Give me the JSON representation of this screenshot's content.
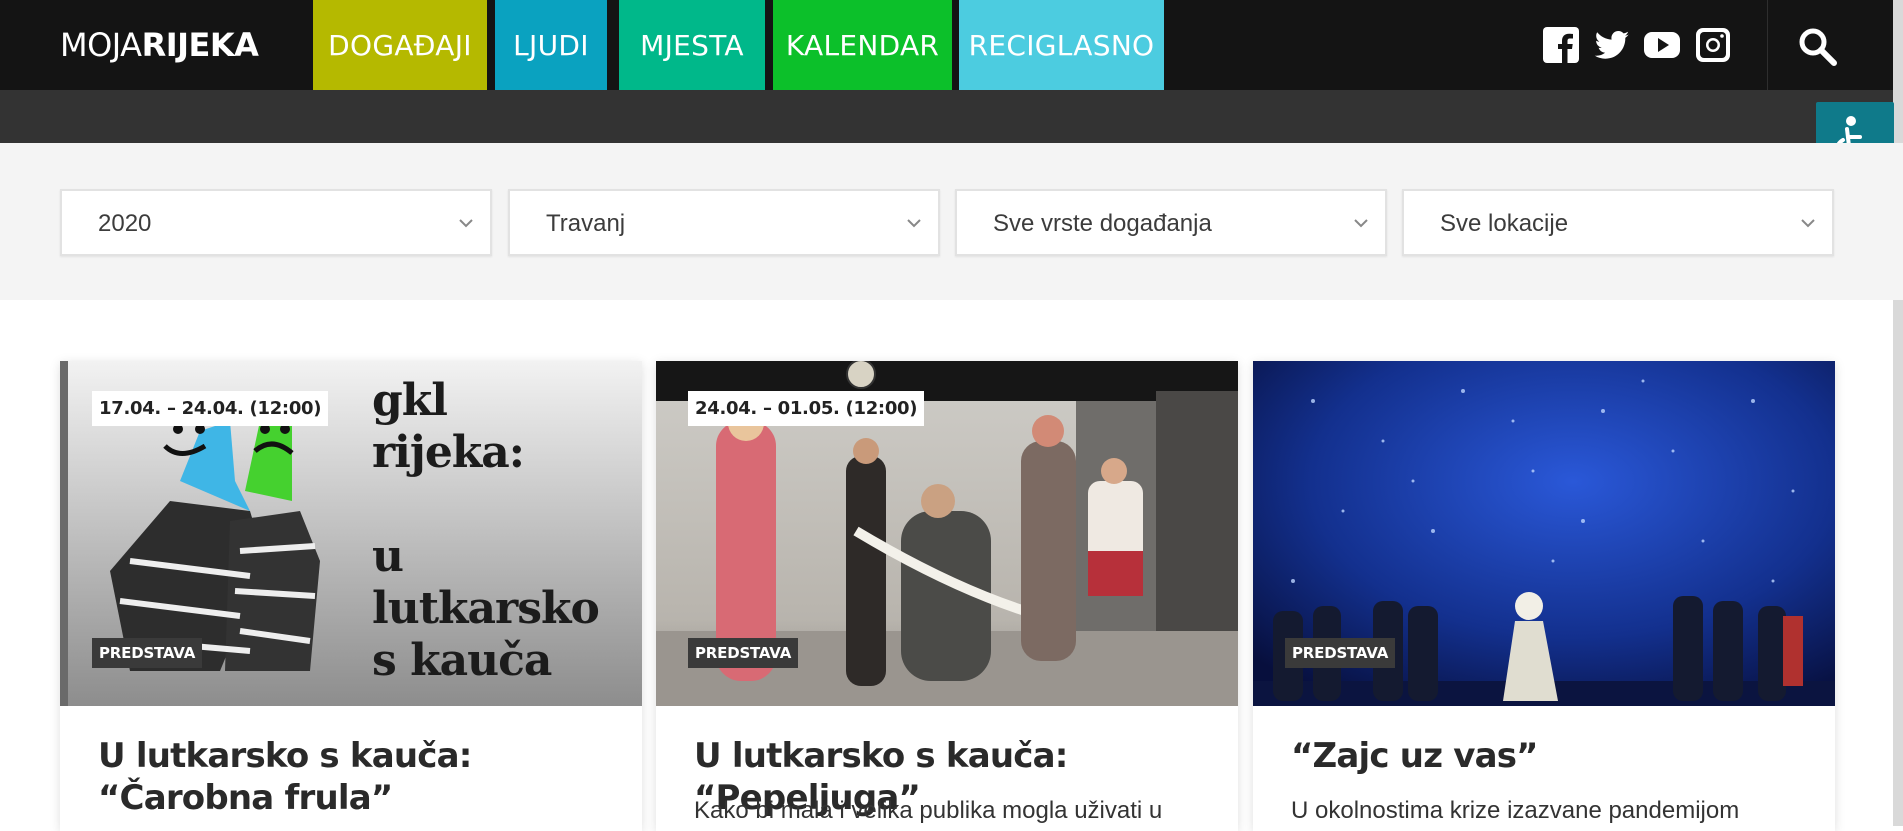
{
  "header": {
    "logo_regular": "MOJA",
    "logo_bold": "RIJEKA",
    "nav": [
      {
        "label": "DOGAĐAJI",
        "color": "#b5b900"
      },
      {
        "label": "LJUDI",
        "color": "#0aa2c0"
      },
      {
        "label": "MJESTA",
        "color": "#00b88a"
      },
      {
        "label": "KALENDAR",
        "color": "#0cc02a"
      },
      {
        "label": "RECIGLASNO",
        "color": "#4ccce0"
      }
    ],
    "social_icons": [
      "facebook-icon",
      "twitter-icon",
      "youtube-icon",
      "instagram-icon"
    ],
    "search_icon": "search-icon"
  },
  "accessibility_icon": "accessibility-icon",
  "filters": {
    "year": "2020",
    "month": "Travanj",
    "type": "Sve vrste događanja",
    "location": "Sve lokacije"
  },
  "cards": [
    {
      "date": "17.04. – 24.04. (12:00)",
      "category": "PREDSTAVA",
      "title": "U lutkarsko s kauča: “Čarobna frula”",
      "description": "",
      "poster_text": [
        "gkl",
        "rijeka:",
        "",
        "u",
        "lutkarsko",
        "s kauča"
      ]
    },
    {
      "date": "24.04. – 01.05. (12:00)",
      "category": "PREDSTAVA",
      "title": "U lutkarsko s kauča: “Pepeljuga”",
      "description": "Kako bi mala i velika publika mogla uživati u"
    },
    {
      "date": "",
      "category": "PREDSTAVA",
      "title": "“Zajc uz vas”",
      "description": "U okolnostima krize izazvane pandemijom"
    }
  ]
}
